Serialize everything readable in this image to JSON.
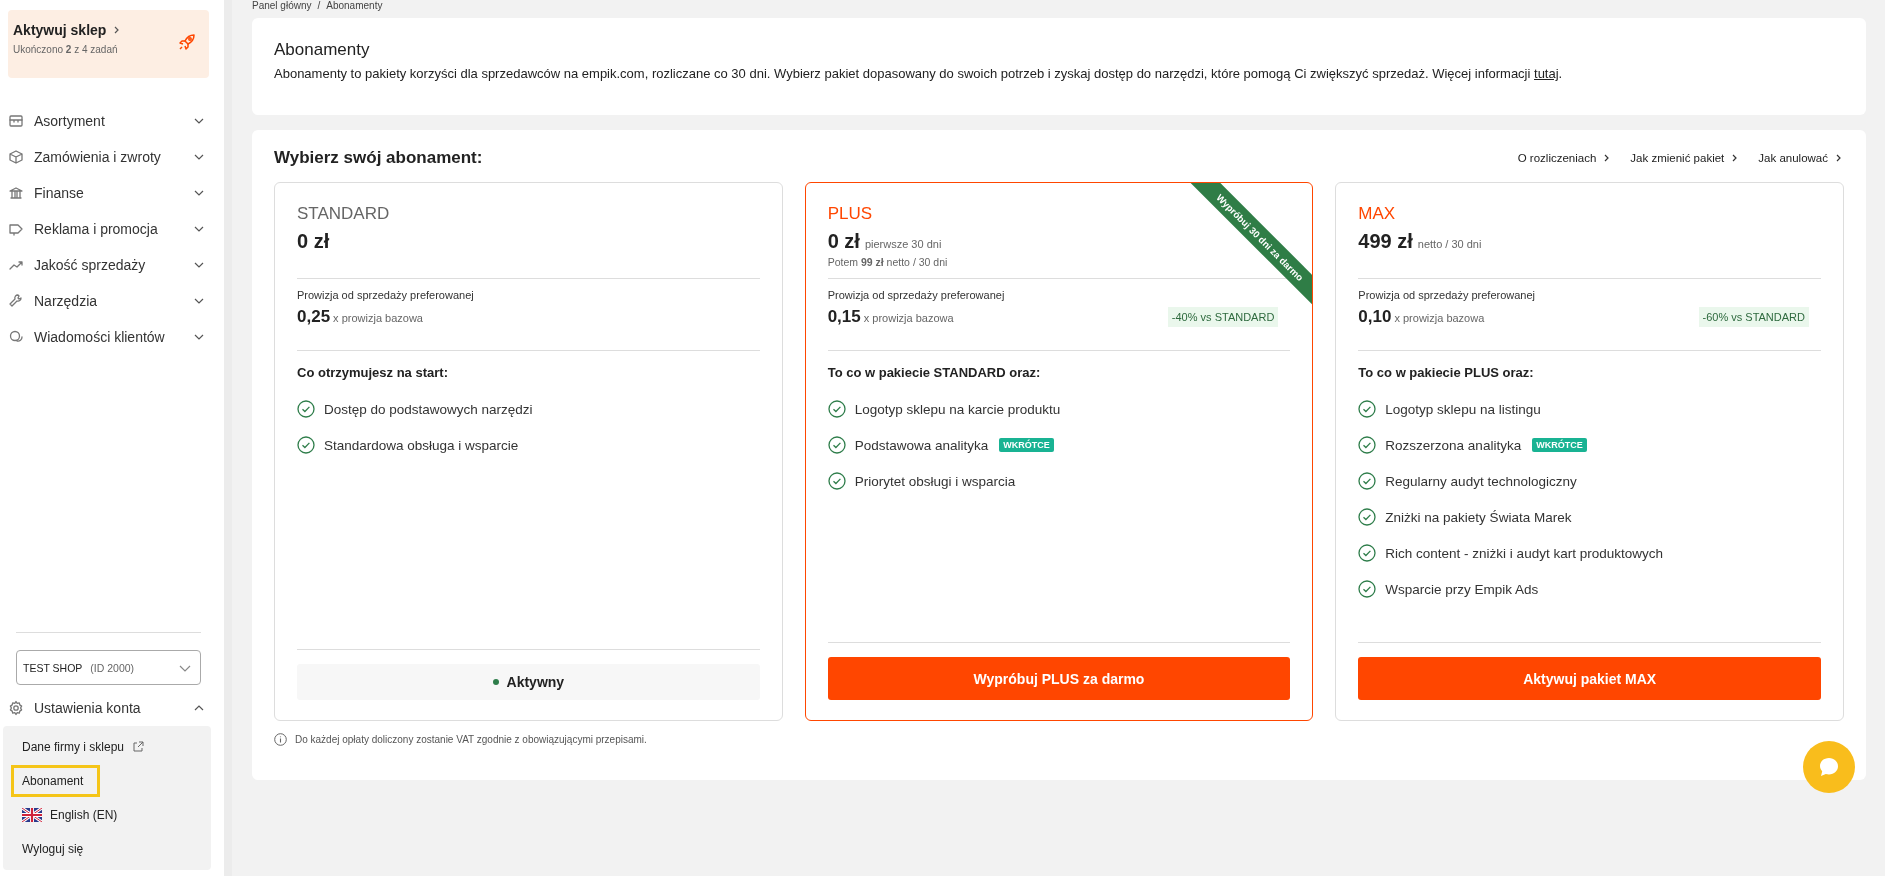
{
  "sidebar": {
    "activation": {
      "title": "Aktywuj sklep",
      "progress": "Ukończono **2** z 4 zadań"
    },
    "nav": [
      {
        "label": "Asortyment",
        "expanded": false
      },
      {
        "label": "Zamówienia i zwroty",
        "expanded": false
      },
      {
        "label": "Finanse",
        "expanded": false
      },
      {
        "label": "Reklama i promocja",
        "expanded": false
      },
      {
        "label": "Jakość sprzedaży",
        "expanded": false
      },
      {
        "label": "Narzędzia",
        "expanded": false
      },
      {
        "label": "Wiadomości klientów",
        "expanded": false
      }
    ],
    "shop_select": {
      "value": "TEST SHOP",
      "id": "(ID 2000)"
    },
    "settings": {
      "label": "Ustawienia konta",
      "expanded": true,
      "children": [
        {
          "label": "Dane firmy i sklepu",
          "kind": "external",
          "selected": false
        },
        {
          "label": "Abonament",
          "kind": "plain",
          "selected": true
        },
        {
          "label": "English (EN)",
          "kind": "language",
          "selected": false
        },
        {
          "label": "Wyloguj się",
          "kind": "plain",
          "selected": false
        }
      ]
    }
  },
  "breadcrumb": {
    "separator": "/",
    "items": [
      "Panel główny",
      "Abonamenty"
    ]
  },
  "intro": {
    "title": "Abonamenty",
    "description": "Abonamenty to pakiety korzyści dla sprzedawców na empik.com, rozliczane co 30 dni. Wybierz pakiet dopasowany do swoich potrzeb i zyskaj dostęp do narzędzi, które pomogą Ci zwiększyć sprzedaż. Więcej informacji ",
    "link": "tutaj",
    "description_end": "."
  },
  "plans_section": {
    "title": "Wybierz swój abonament:",
    "links": [
      "O rozliczeniach",
      "Jak zmienić pakiet",
      "Jak anulować"
    ],
    "plans": [
      {
        "name": "STANDARD",
        "color": "#666666",
        "featured": false,
        "price": "0 zł",
        "commission_label": "Prowizja od sprzedaży preferowanej",
        "commission_value": "0,25",
        "commission_unit": "x prowizja bazowa",
        "features_title": "Co otrzymujesz na start:",
        "features": [
          {
            "text": "Dostęp do podstawowych narzędzi"
          },
          {
            "text": "Standardowa obsługa i wsparcie"
          }
        ],
        "action": {
          "kind": "status",
          "label": "Aktywny"
        }
      },
      {
        "name": "PLUS",
        "color": "#ff4600",
        "featured": true,
        "ribbon": "Wypróbuj 30 dni za darmo",
        "price": "0 zł",
        "price_note": "pierwsze 30 dni",
        "price_after": "Potem **99 zł** netto / 30 dni",
        "commission_label": "Prowizja od sprzedaży preferowanej",
        "commission_value": "0,15",
        "commission_unit": "x prowizja bazowa",
        "discount": "-40% vs STANDARD",
        "features_title": "To co w pakiecie STANDARD oraz:",
        "features": [
          {
            "text": "Logotyp sklepu na karcie produktu"
          },
          {
            "text": "Podstawowa analityka",
            "badge": "WKRÓTCE"
          },
          {
            "text": "Priorytet obsługi i wsparcia"
          }
        ],
        "action": {
          "kind": "button",
          "label": "Wypróbuj PLUS za darmo"
        }
      },
      {
        "name": "MAX",
        "color": "#ff4600",
        "featured": false,
        "price": "499 zł",
        "price_note": "netto / 30 dni",
        "commission_label": "Prowizja od sprzedaży preferowanej",
        "commission_value": "0,10",
        "commission_unit": "x prowizja bazowa",
        "discount": "-60% vs STANDARD",
        "features_title": "To co w pakiecie PLUS oraz:",
        "features": [
          {
            "text": "Logotyp sklepu na listingu"
          },
          {
            "text": "Rozszerzona analityka",
            "badge": "WKRÓTCE"
          },
          {
            "text": "Regularny audyt technologiczny"
          },
          {
            "text": "Zniżki na pakiety Świata Marek"
          },
          {
            "text": "Rich content - zniżki i audyt kart produktowych"
          },
          {
            "text": "Wsparcie przy Empik Ads"
          }
        ],
        "action": {
          "kind": "button",
          "label": "Aktywuj pakiet MAX"
        }
      }
    ],
    "footnote": "Do każdej opłaty doliczony zostanie VAT zgodnie z obowiązującymi przepisami."
  }
}
